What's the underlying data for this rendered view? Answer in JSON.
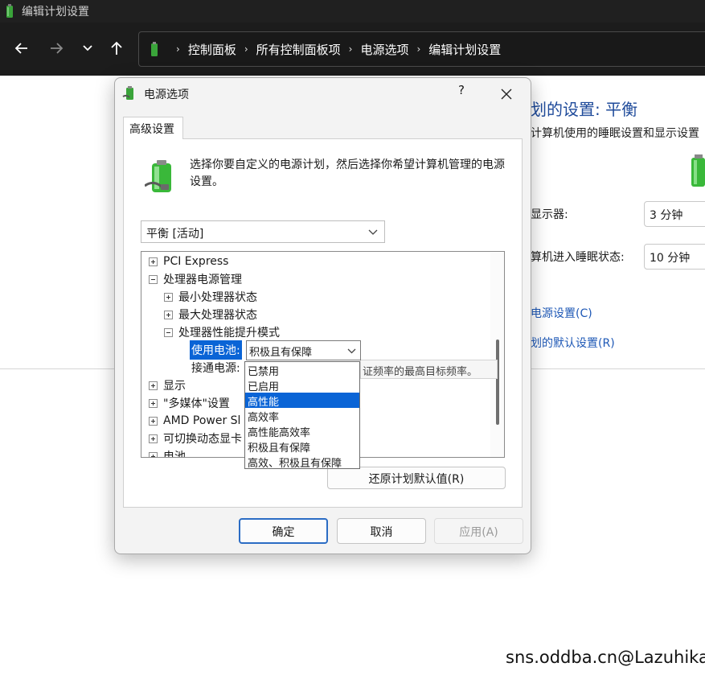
{
  "window": {
    "title": "编辑计划设置"
  },
  "address_bar": {
    "crumbs": [
      "控制面板",
      "所有控制面板项",
      "电源选项",
      "编辑计划设置"
    ]
  },
  "background_page": {
    "title": "划的设置: 平衡",
    "description": "计算机使用的睡眠设置和显示设置",
    "display_label": "显示器:",
    "display_value": "3 分钟",
    "sleep_label": "算机进入睡眠状态:",
    "sleep_value": "10 分钟",
    "link_power_settings": "电源设置(C)",
    "link_restore_defaults": "划的默认设置(R)"
  },
  "dialog": {
    "title": "电源选项",
    "help": "?",
    "tab": "高级设置",
    "intro": "选择你要自定义的电源计划，然后选择你希望计算机管理的电源设置。",
    "plan_selected": "平衡 [活动]",
    "tree": [
      {
        "label": "PCI Express",
        "expander": "plus"
      },
      {
        "label": "处理器电源管理",
        "expander": "minus"
      },
      {
        "label": "最小处理器状态",
        "expander": "plus"
      },
      {
        "label": "最大处理器状态",
        "expander": "plus"
      },
      {
        "label": "处理器性能提升模式",
        "expander": "minus"
      },
      {
        "label": "使用电池:"
      },
      {
        "label": "接通电源:"
      },
      {
        "label": "显示",
        "expander": "plus"
      },
      {
        "label": "\"多媒体\"设置",
        "expander": "plus"
      },
      {
        "label": "AMD Power Sl",
        "expander": "plus"
      },
      {
        "label": "可切换动态显卡",
        "expander": "plus"
      },
      {
        "label": "电池",
        "expander": "plus"
      }
    ],
    "battery_combo_value": "积极且有保障",
    "tooltip": "证频率的最高目标频率。",
    "dropdown_options": [
      "已禁用",
      "已启用",
      "高性能",
      "高效率",
      "高性能高效率",
      "积极且有保障",
      "高效、积极且有保障"
    ],
    "dropdown_highlighted": "高性能",
    "restore_button": "还原计划默认值(R)",
    "ok_button": "确定",
    "cancel_button": "取消",
    "apply_button": "应用(A)"
  },
  "watermark": "sns.oddba.cn@Lazuhika",
  "colors": {
    "accent": "#0a64d6",
    "link": "#1e58b6",
    "title_blue": "#1e4a9a",
    "chrome_dark": "#1c1c1c"
  }
}
